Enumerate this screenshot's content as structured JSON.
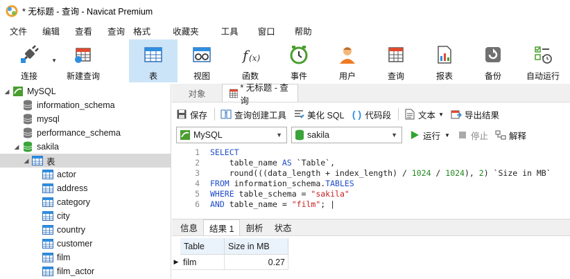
{
  "window": {
    "title": "* 无标题 - 查询 - Navicat Premium"
  },
  "menu": [
    "文件",
    "编辑",
    "查看",
    "查询",
    "格式",
    "收藏夹",
    "工具",
    "窗口",
    "帮助"
  ],
  "toolbar": [
    {
      "label": "连接",
      "icon": "connect-plug-icon"
    },
    {
      "label": "新建查询",
      "icon": "new-query-icon"
    },
    {
      "label": "表",
      "icon": "table-icon"
    },
    {
      "label": "视图",
      "icon": "view-icon"
    },
    {
      "label": "函数",
      "icon": "function-icon"
    },
    {
      "label": "事件",
      "icon": "event-clock-icon"
    },
    {
      "label": "用户",
      "icon": "user-icon"
    },
    {
      "label": "查询",
      "icon": "query-icon"
    },
    {
      "label": "报表",
      "icon": "report-icon"
    },
    {
      "label": "备份",
      "icon": "backup-icon"
    },
    {
      "label": "自动运行",
      "icon": "automation-icon"
    }
  ],
  "tree": {
    "connection": "MySQL",
    "databases": [
      "information_schema",
      "mysql",
      "performance_schema",
      "sakila"
    ],
    "tables_folder": "表",
    "tables": [
      "actor",
      "address",
      "category",
      "city",
      "country",
      "customer",
      "film",
      "film_actor"
    ]
  },
  "tabs": {
    "objects": "对象",
    "query": "* 无标题 - 查询"
  },
  "query_toolbar": {
    "save": "保存",
    "builder": "查询创建工具",
    "beautify": "美化 SQL",
    "snippet": "代码段",
    "text": "文本",
    "export": "导出结果"
  },
  "connection_bar": {
    "connection": "MySQL",
    "database": "sakila",
    "run": "运行",
    "stop": "停止",
    "explain": "解释"
  },
  "editor": {
    "line_numbers": [
      "1",
      "2",
      "3",
      "4",
      "5",
      "6"
    ]
  },
  "result_tabs": [
    "信息",
    "结果 1",
    "剖析",
    "状态"
  ],
  "result": {
    "columns": [
      "Table",
      "Size in MB"
    ],
    "rows": [
      [
        "film",
        "0.27"
      ]
    ]
  }
}
